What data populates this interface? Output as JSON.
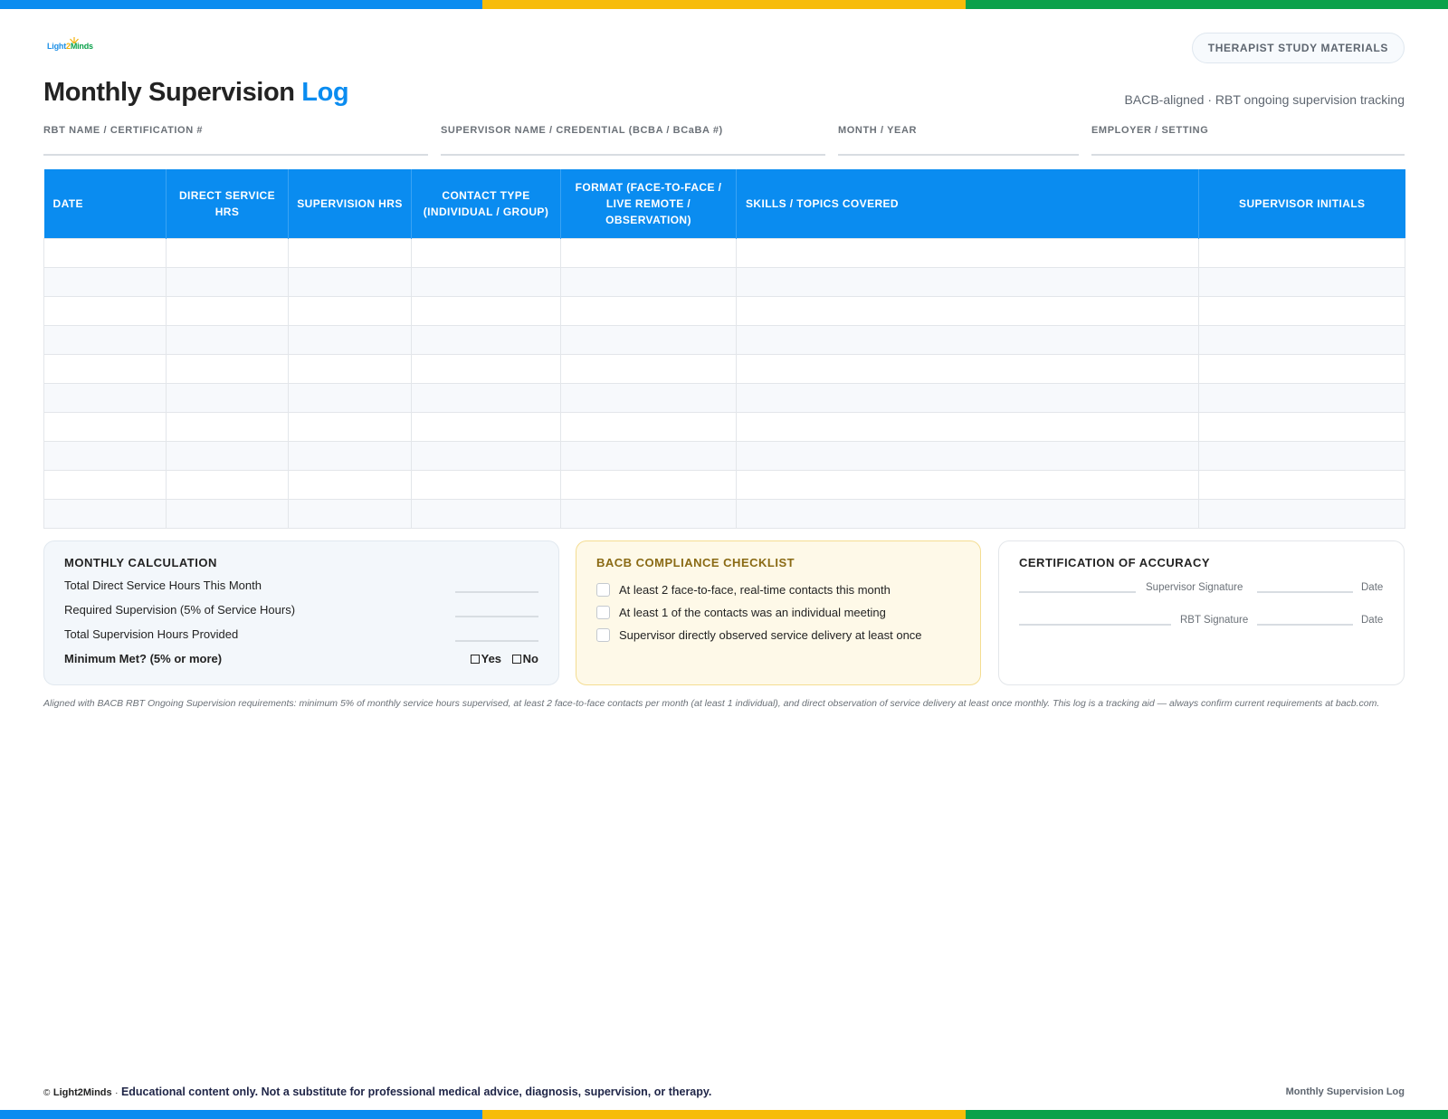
{
  "brand": {
    "logo_parts": [
      "Light",
      "2",
      "Minds"
    ],
    "badge": "THERAPIST STUDY MATERIALS",
    "colors": {
      "blue": "#0a8cf0",
      "yellow": "#f7bc0a",
      "green": "#0aa14a"
    }
  },
  "header": {
    "title": "Monthly Supervision",
    "title_accent": "Log",
    "subtitle": "BACB-aligned · RBT ongoing supervision tracking"
  },
  "fields": [
    "RBT NAME / CERTIFICATION #",
    "SUPERVISOR NAME / CREDENTIAL (BCBA / BCaBA #)",
    "MONTH / YEAR",
    "EMPLOYER / SETTING"
  ],
  "table": {
    "columns": [
      "DATE",
      "DIRECT SERVICE HRS",
      "SUPERVISION HRS",
      "CONTACT TYPE (INDIVIDUAL / GROUP)",
      "FORMAT (FACE-TO-FACE / LIVE REMOTE / OBSERVATION)",
      "SKILLS / TOPICS COVERED",
      "SUPERVISOR INITIALS"
    ],
    "row_count": 10
  },
  "calc": {
    "title": "MONTHLY CALCULATION",
    "rows": [
      "Total Direct Service Hours This Month",
      "Required Supervision (5% of Service Hours)",
      "Total Supervision Hours Provided"
    ],
    "minimum_label": "Minimum Met? (5% or more)",
    "yes": "Yes",
    "no": "No"
  },
  "checklist": {
    "title": "BACB COMPLIANCE CHECKLIST",
    "items": [
      "At least 2 face-to-face, real-time contacts this month",
      "At least 1 of the contacts was an individual meeting",
      "Supervisor directly observed service delivery at least once"
    ]
  },
  "certification": {
    "title": "CERTIFICATION OF ACCURACY",
    "supervisor_signature": "Supervisor Signature",
    "rbt_signature": "RBT Signature",
    "date": "Date"
  },
  "footnote": "Aligned with BACB RBT Ongoing Supervision requirements: minimum 5% of monthly service hours supervised, at least 2 face-to-face contacts per month (at least 1 individual), and direct observation of service delivery at least once monthly. This log is a tracking aid — always confirm current requirements at bacb.com.",
  "footer": {
    "copyright": "©",
    "brand": "Light2Minds",
    "separator": "·",
    "disclaimer": "Educational content only. Not a substitute for professional medical advice, diagnosis, supervision, or therapy.",
    "doc_name": "Monthly Supervision Log"
  }
}
